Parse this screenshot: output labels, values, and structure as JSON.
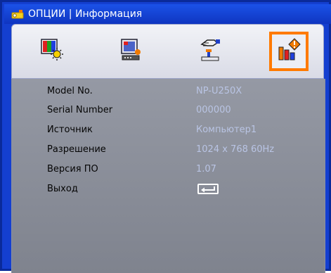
{
  "window": {
    "title": "ОПЦИИ | Информация",
    "icon": "projector-icon"
  },
  "tabs": [
    {
      "name": "image-settings",
      "icon": "color-image-icon",
      "active": false
    },
    {
      "name": "display",
      "icon": "screen-display-icon",
      "active": false
    },
    {
      "name": "setup",
      "icon": "hand-setup-icon",
      "active": false
    },
    {
      "name": "options",
      "icon": "info-bar-chart-icon",
      "active": true
    }
  ],
  "info": {
    "model_label": "Model No.",
    "model_value": "NP-U250X",
    "serial_label": "Serial Number",
    "serial_value": "000000",
    "source_label": "Источник",
    "source_value": "Компьютер1",
    "resolution_label": "Разрешение",
    "resolution_value": "1024 x 768  60Hz",
    "firmware_label": "Версия ПО",
    "firmware_value": "1.07",
    "exit_label": "Выход",
    "exit_icon": "enter-return-icon"
  },
  "colors": {
    "frame": "#143fd0",
    "active_tab_border": "#ff7a00",
    "value_text": "#b9c4e4"
  }
}
